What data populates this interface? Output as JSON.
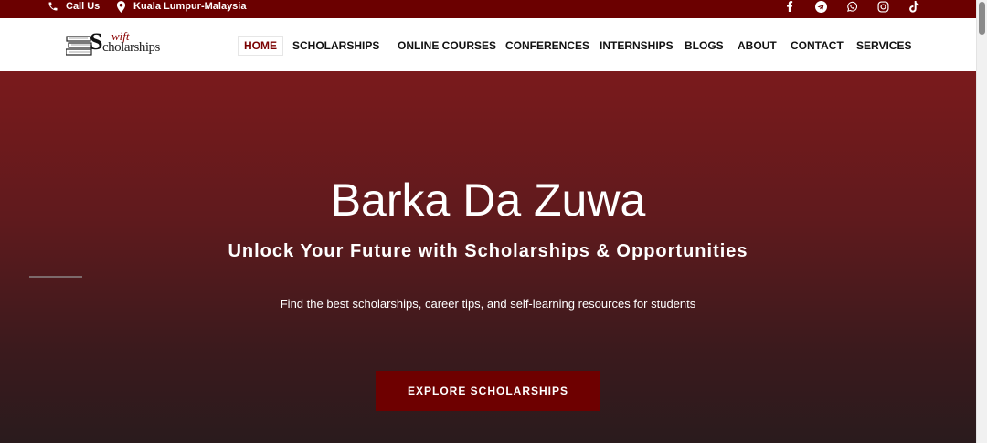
{
  "topbar": {
    "call_label": "Call Us",
    "location_label": "Kuala Lumpur-Malaysia",
    "social": [
      "facebook-icon",
      "telegram-icon",
      "whatsapp-icon",
      "instagram-icon",
      "tiktok-icon"
    ]
  },
  "logo": {
    "line1": "wift",
    "letter": "S",
    "line2": "cholarships"
  },
  "nav": {
    "home": "HOME",
    "scholarships": "SCHOLARSHIPS",
    "online_courses": "ONLINE COURSES",
    "conferences": "CONFERENCES",
    "internships": "INTERNSHIPS",
    "blogs": "BLOGS",
    "about": "ABOUT",
    "contact": "CONTACT",
    "services": "SERVICES"
  },
  "hero": {
    "title": "Barka Da Zuwa",
    "subtitle": "Unlock Your Future with Scholarships & Opportunities",
    "description": "Find the best scholarships, career tips, and self-learning resources for students",
    "button_label": "EXPLORE SCHOLARSHIPS"
  },
  "colors": {
    "topbar": "#6b0000",
    "accent": "#7a0000",
    "button": "#6e0000"
  }
}
